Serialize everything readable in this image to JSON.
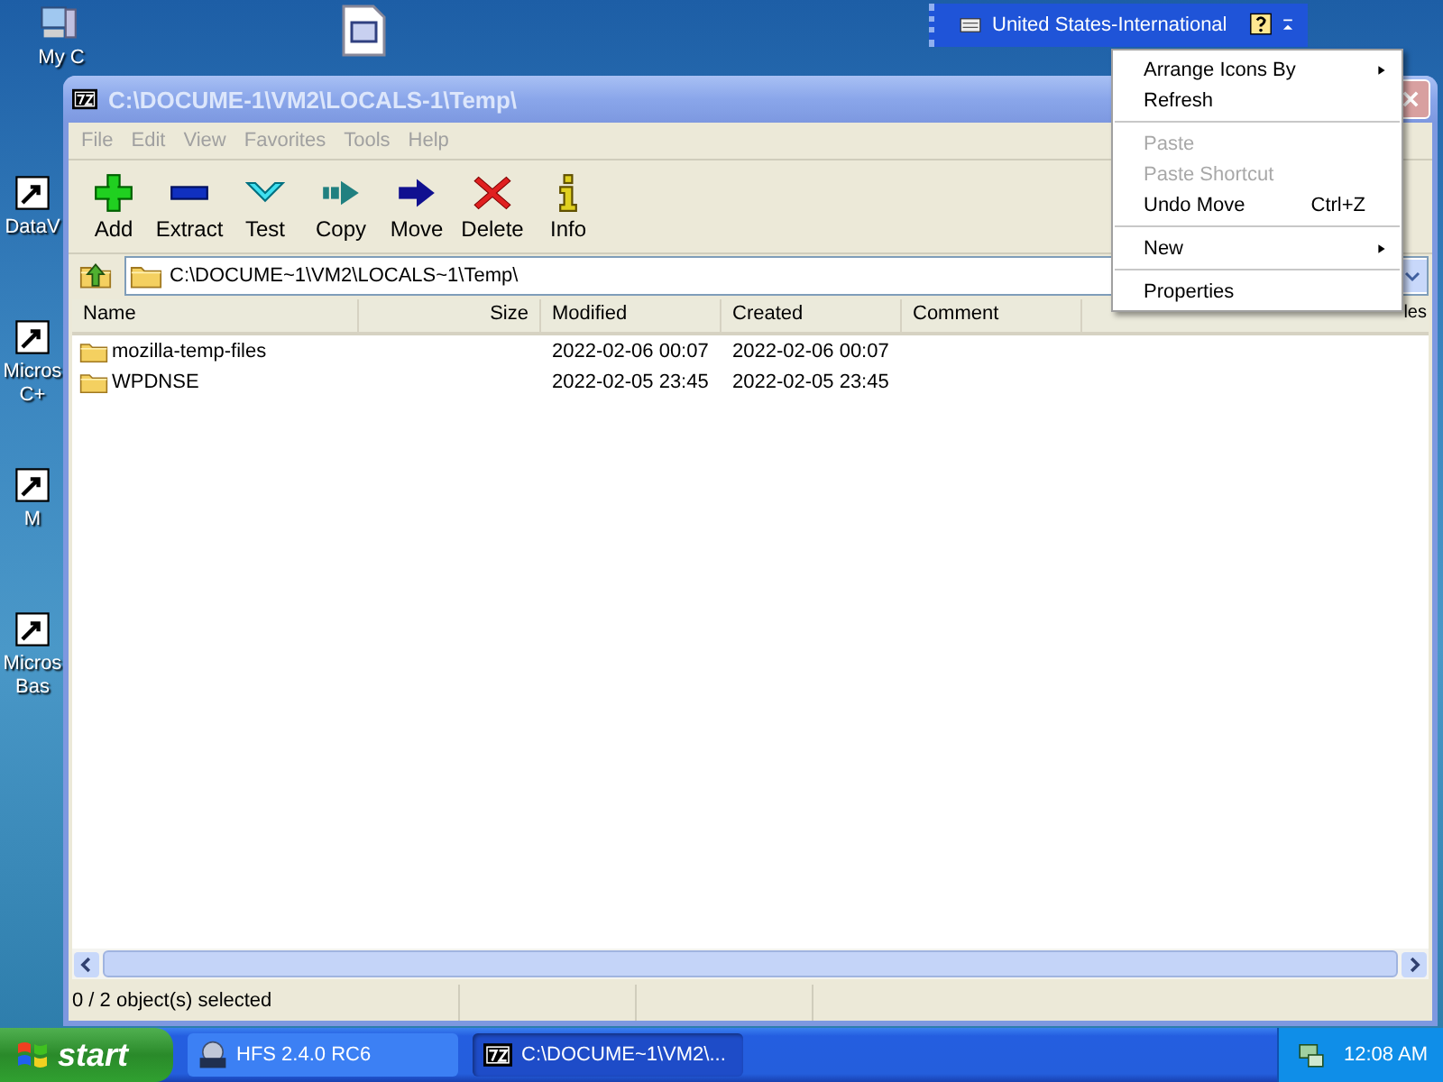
{
  "language_bar": {
    "label": "United States-International"
  },
  "desktop_icons": [
    {
      "label": "My C",
      "kind": "computer"
    },
    {
      "label": "DataV",
      "kind": "shortcut"
    },
    {
      "label": "Micros\nC+",
      "kind": "shortcut"
    },
    {
      "label": "M",
      "kind": "shortcut"
    },
    {
      "label": "Micros\nBas",
      "kind": "shortcut"
    },
    {
      "kind": "file"
    }
  ],
  "window": {
    "title": "C:\\DOCUME-1\\VM2\\LOCALS-1\\Temp\\",
    "active": false,
    "menu": [
      "File",
      "Edit",
      "View",
      "Favorites",
      "Tools",
      "Help"
    ],
    "toolbar": [
      {
        "label": "Add",
        "kind": "add"
      },
      {
        "label": "Extract",
        "kind": "extract"
      },
      {
        "label": "Test",
        "kind": "test"
      },
      {
        "label": "Copy",
        "kind": "copy"
      },
      {
        "label": "Move",
        "kind": "move"
      },
      {
        "label": "Delete",
        "kind": "delete"
      },
      {
        "label": "Info",
        "kind": "info"
      }
    ],
    "address": "C:\\DOCUME~1\\VM2\\LOCALS~1\\Temp\\",
    "table": {
      "columns": [
        "Name",
        "Size",
        "Modified",
        "Created",
        "Comment",
        "les"
      ],
      "rows": [
        {
          "name": "mozilla-temp-files",
          "modified": "2022-02-06 00:07",
          "created": "2022-02-06 00:07"
        },
        {
          "name": "WPDNSE",
          "modified": "2022-02-05 23:45",
          "created": "2022-02-05 23:45"
        }
      ]
    },
    "status_bar": "0 / 2 object(s) selected"
  },
  "context_menu": [
    [
      {
        "label": "Arrange Icons By",
        "disabled": false,
        "submenu": true
      },
      {
        "label": "Refresh",
        "disabled": false,
        "submenu": false
      }
    ],
    [
      {
        "label": "Paste",
        "disabled": true,
        "submenu": false
      },
      {
        "label": "Paste Shortcut",
        "disabled": true,
        "submenu": false
      },
      {
        "label": "Undo Move",
        "shortcut": "Ctrl+Z",
        "disabled": false,
        "submenu": false
      }
    ],
    [
      {
        "label": "New",
        "disabled": false,
        "submenu": true
      }
    ],
    [
      {
        "label": "Properties",
        "disabled": false,
        "submenu": false
      }
    ]
  ],
  "taskbar": {
    "start": "start",
    "tasks": [
      {
        "label": "HFS 2.4.0 RC6",
        "kind": "hfs",
        "selected": false
      },
      {
        "label": "C:\\DOCUME~1\\VM2\\...",
        "kind": "sevenzip",
        "selected": true
      }
    ],
    "clock": "12:08 AM"
  }
}
